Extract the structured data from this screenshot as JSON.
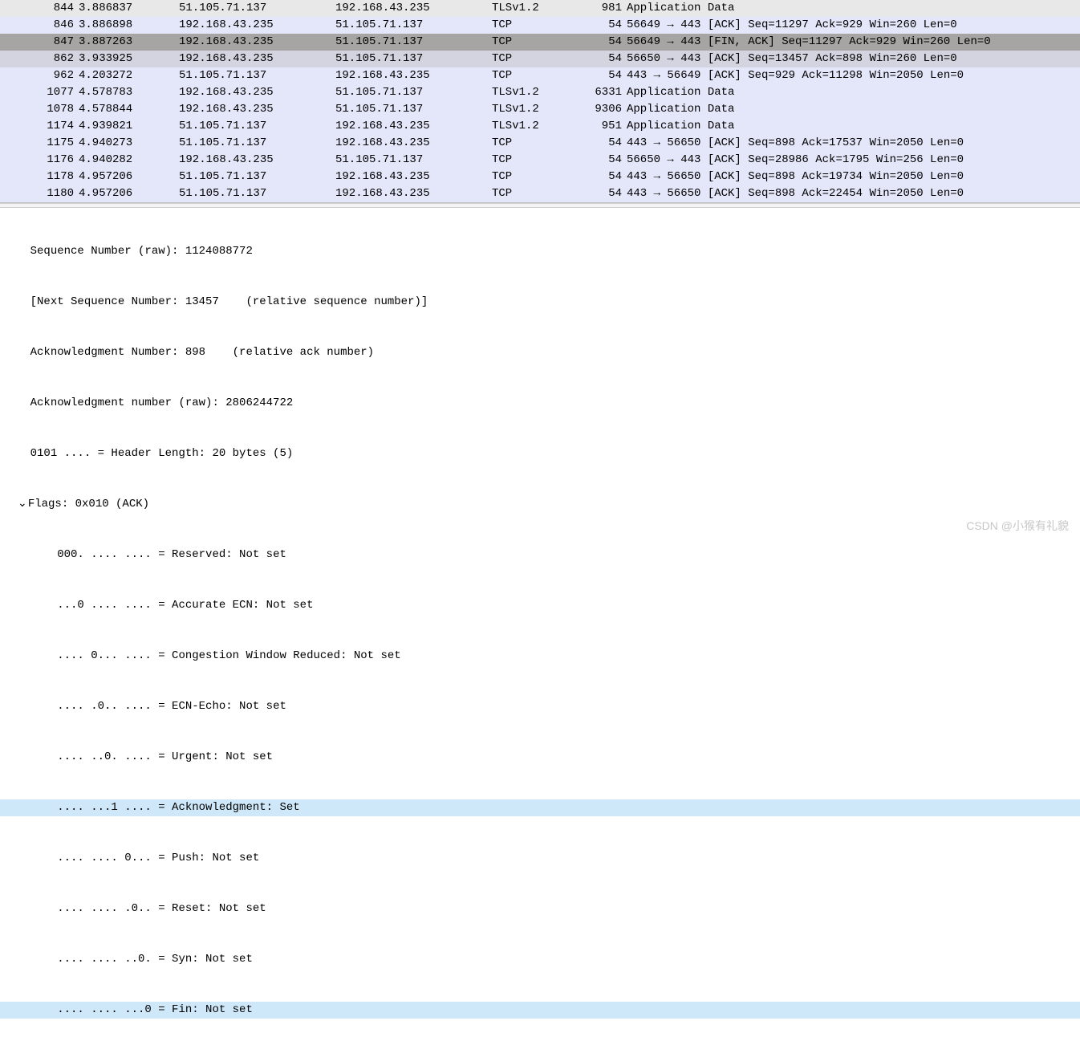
{
  "packets": [
    {
      "no": "844",
      "time": "3.886837",
      "src": "51.105.71.137",
      "dst": "192.168.43.235",
      "proto": "TLSv1.2",
      "len": "981",
      "info": "Application Data",
      "style": "row-gray"
    },
    {
      "no": "846",
      "time": "3.886898",
      "src": "192.168.43.235",
      "dst": "51.105.71.137",
      "proto": "TCP",
      "len": "54",
      "info": "56649 → 443 [ACK] Seq=11297 Ack=929 Win=260 Len=0",
      "style": "row-light"
    },
    {
      "no": "847",
      "time": "3.887263",
      "src": "192.168.43.235",
      "dst": "51.105.71.137",
      "proto": "TCP",
      "len": "54",
      "info": "56649 → 443 [FIN, ACK] Seq=11297 Ack=929 Win=260 Len=0",
      "style": "row-gray2"
    },
    {
      "no": "862",
      "time": "3.933925",
      "src": "192.168.43.235",
      "dst": "51.105.71.137",
      "proto": "TCP",
      "len": "54",
      "info": "56650 → 443 [ACK] Seq=13457 Ack=898 Win=260 Len=0",
      "style": "row-mid"
    },
    {
      "no": "962",
      "time": "4.203272",
      "src": "51.105.71.137",
      "dst": "192.168.43.235",
      "proto": "TCP",
      "len": "54",
      "info": "443 → 56649 [ACK] Seq=929 Ack=11298 Win=2050 Len=0",
      "style": "row-light"
    },
    {
      "no": "1077",
      "time": "4.578783",
      "src": "192.168.43.235",
      "dst": "51.105.71.137",
      "proto": "TLSv1.2",
      "len": "6331",
      "info": "Application Data",
      "style": "row-light"
    },
    {
      "no": "1078",
      "time": "4.578844",
      "src": "192.168.43.235",
      "dst": "51.105.71.137",
      "proto": "TLSv1.2",
      "len": "9306",
      "info": "Application Data",
      "style": "row-light"
    },
    {
      "no": "1174",
      "time": "4.939821",
      "src": "51.105.71.137",
      "dst": "192.168.43.235",
      "proto": "TLSv1.2",
      "len": "951",
      "info": "Application Data",
      "style": "row-light"
    },
    {
      "no": "1175",
      "time": "4.940273",
      "src": "51.105.71.137",
      "dst": "192.168.43.235",
      "proto": "TCP",
      "len": "54",
      "info": "443 → 56650 [ACK] Seq=898 Ack=17537 Win=2050 Len=0",
      "style": "row-light"
    },
    {
      "no": "1176",
      "time": "4.940282",
      "src": "192.168.43.235",
      "dst": "51.105.71.137",
      "proto": "TCP",
      "len": "54",
      "info": "56650 → 443 [ACK] Seq=28986 Ack=1795 Win=256 Len=0",
      "style": "row-light"
    },
    {
      "no": "1178",
      "time": "4.957206",
      "src": "51.105.71.137",
      "dst": "192.168.43.235",
      "proto": "TCP",
      "len": "54",
      "info": "443 → 56650 [ACK] Seq=898 Ack=19734 Win=2050 Len=0",
      "style": "row-light"
    },
    {
      "no": "1180",
      "time": "4.957206",
      "src": "51.105.71.137",
      "dst": "192.168.43.235",
      "proto": "TCP",
      "len": "54",
      "info": "443 → 56650 [ACK] Seq=898 Ack=22454 Win=2050 Len=0",
      "style": "row-light"
    }
  ],
  "detail": {
    "seq_raw": "Sequence Number (raw): 1124088772",
    "next_seq": "[Next Sequence Number: 13457    (relative sequence number)]",
    "ack_num": "Acknowledgment Number: 898    (relative ack number)",
    "ack_raw": "Acknowledgment number (raw): 2806244722",
    "header_len": "0101 .... = Header Length: 20 bytes (5)",
    "flags_header": "Flags: 0x010 (ACK)",
    "f_reserved": "000. .... .... = Reserved: Not set",
    "f_aecn": "...0 .... .... = Accurate ECN: Not set",
    "f_cwr": ".... 0... .... = Congestion Window Reduced: Not set",
    "f_ecn": ".... .0.. .... = ECN-Echo: Not set",
    "f_urg": ".... ..0. .... = Urgent: Not set",
    "f_ack": ".... ...1 .... = Acknowledgment: Set",
    "f_push": ".... .... 0... = Push: Not set",
    "f_reset": ".... .... .0.. = Reset: Not set",
    "f_syn": ".... .... ..0. = Syn: Not set",
    "f_fin": ".... .... ...0 = Fin: Not set"
  },
  "watermark": "CSDN @小猴有礼貌",
  "toggle": "⌄"
}
